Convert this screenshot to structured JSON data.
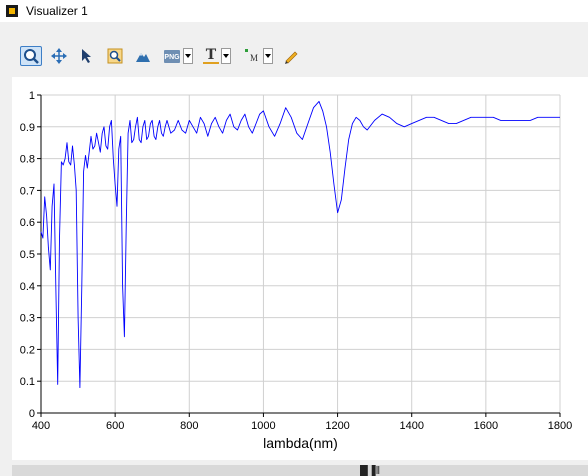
{
  "window": {
    "title": "Visualizer 1"
  },
  "toolbar": {
    "buttons": [
      {
        "name": "zoom-tool",
        "icon": "magnifier-icon",
        "active": true
      },
      {
        "name": "pan-tool",
        "icon": "move-arrows-icon"
      },
      {
        "name": "select-tool",
        "icon": "pointer-arrow-icon"
      },
      {
        "name": "zoom-fit-tool",
        "icon": "zoom-box-icon"
      },
      {
        "name": "autoscale-tool",
        "icon": "mountain-icon"
      },
      {
        "name": "export-png",
        "icon": "png-icon",
        "label": "PNG",
        "dropdown": true
      },
      {
        "name": "text-tool",
        "icon": "text-t-icon",
        "label": "T",
        "dropdown": true
      },
      {
        "name": "marker-tool",
        "icon": "marker-icon",
        "label": "M",
        "dropdown": true
      },
      {
        "name": "pencil-tool",
        "icon": "pencil-icon"
      }
    ]
  },
  "bottom_bar": {
    "text": "█▐‖"
  },
  "colors": {
    "series": "#0000ff",
    "grid": "#d0d0d0",
    "accent": "#3d7ec6"
  },
  "chart_data": {
    "type": "line",
    "title": "",
    "xlabel": "lambda(nm)",
    "ylabel": "",
    "xlim": [
      400,
      1800
    ],
    "ylim": [
      0,
      1
    ],
    "grid": true,
    "xticks": [
      400,
      600,
      800,
      1000,
      1200,
      1400,
      1600,
      1800
    ],
    "yticks": [
      0,
      0.1,
      0.2,
      0.3,
      0.4,
      0.5,
      0.6,
      0.7,
      0.8,
      0.9,
      1
    ],
    "series": [
      {
        "color": "#0000ff",
        "x": [
          400,
          405,
          410,
          415,
          420,
          425,
          430,
          435,
          440,
          445,
          450,
          455,
          460,
          465,
          470,
          475,
          480,
          485,
          490,
          495,
          500,
          505,
          510,
          515,
          520,
          525,
          530,
          535,
          540,
          545,
          550,
          555,
          560,
          565,
          570,
          575,
          580,
          585,
          590,
          595,
          600,
          605,
          610,
          615,
          620,
          625,
          630,
          635,
          640,
          645,
          650,
          655,
          660,
          665,
          670,
          675,
          680,
          685,
          690,
          695,
          700,
          705,
          710,
          715,
          720,
          725,
          730,
          735,
          740,
          750,
          760,
          770,
          780,
          790,
          800,
          810,
          820,
          830,
          840,
          850,
          860,
          870,
          880,
          890,
          900,
          910,
          920,
          930,
          940,
          950,
          960,
          970,
          980,
          990,
          1000,
          1015,
          1030,
          1045,
          1060,
          1075,
          1090,
          1105,
          1120,
          1135,
          1150,
          1160,
          1170,
          1180,
          1190,
          1200,
          1210,
          1220,
          1230,
          1240,
          1250,
          1260,
          1270,
          1280,
          1300,
          1320,
          1340,
          1360,
          1380,
          1400,
          1420,
          1440,
          1460,
          1480,
          1500,
          1520,
          1540,
          1560,
          1580,
          1600,
          1620,
          1640,
          1660,
          1680,
          1700,
          1720,
          1740,
          1760,
          1780,
          1800
        ],
        "y": [
          0.57,
          0.55,
          0.68,
          0.62,
          0.52,
          0.45,
          0.65,
          0.72,
          0.4,
          0.09,
          0.55,
          0.79,
          0.78,
          0.8,
          0.85,
          0.79,
          0.78,
          0.84,
          0.78,
          0.7,
          0.3,
          0.08,
          0.4,
          0.76,
          0.81,
          0.77,
          0.82,
          0.87,
          0.83,
          0.84,
          0.88,
          0.85,
          0.82,
          0.88,
          0.9,
          0.84,
          0.83,
          0.9,
          0.92,
          0.8,
          0.72,
          0.65,
          0.83,
          0.87,
          0.4,
          0.24,
          0.6,
          0.88,
          0.92,
          0.85,
          0.86,
          0.9,
          0.93,
          0.86,
          0.85,
          0.9,
          0.92,
          0.86,
          0.87,
          0.91,
          0.92,
          0.87,
          0.86,
          0.9,
          0.92,
          0.88,
          0.87,
          0.9,
          0.92,
          0.88,
          0.89,
          0.92,
          0.89,
          0.88,
          0.92,
          0.9,
          0.88,
          0.93,
          0.91,
          0.87,
          0.91,
          0.93,
          0.9,
          0.88,
          0.92,
          0.94,
          0.9,
          0.89,
          0.92,
          0.94,
          0.9,
          0.88,
          0.91,
          0.94,
          0.95,
          0.9,
          0.87,
          0.91,
          0.96,
          0.93,
          0.88,
          0.86,
          0.91,
          0.96,
          0.98,
          0.95,
          0.9,
          0.82,
          0.72,
          0.63,
          0.67,
          0.77,
          0.86,
          0.91,
          0.93,
          0.92,
          0.9,
          0.89,
          0.92,
          0.94,
          0.93,
          0.91,
          0.9,
          0.91,
          0.92,
          0.93,
          0.93,
          0.92,
          0.91,
          0.91,
          0.92,
          0.93,
          0.93,
          0.93,
          0.93,
          0.92,
          0.92,
          0.92,
          0.92,
          0.92,
          0.93,
          0.93,
          0.93,
          0.93
        ]
      }
    ]
  }
}
